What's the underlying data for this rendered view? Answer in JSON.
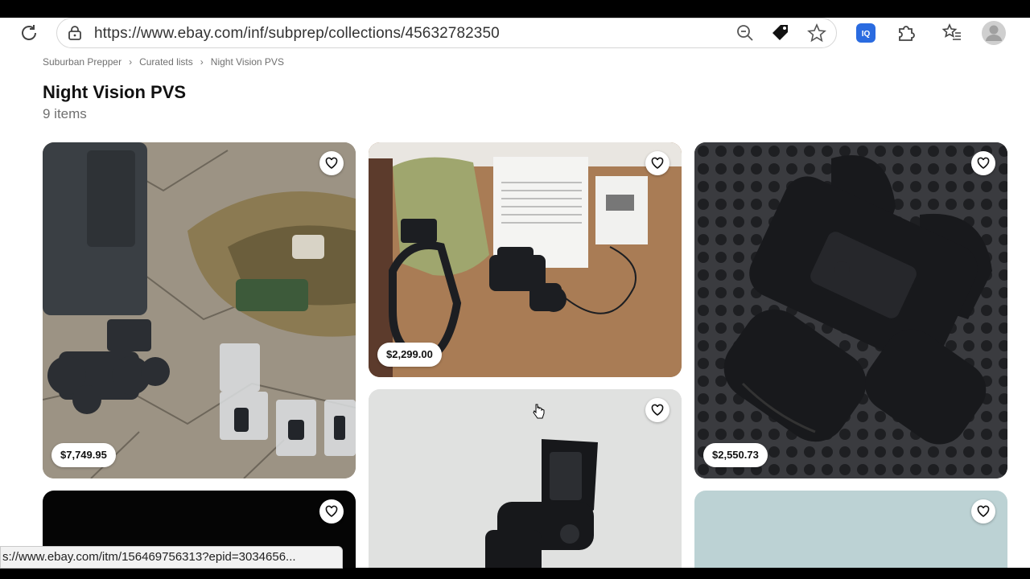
{
  "browser": {
    "url": "https://www.ebay.com/inf/subprep/collections/45632782350",
    "status_url": "s://www.ebay.com/itm/156469756313?epid=3034656..."
  },
  "breadcrumb": {
    "items": [
      "Suburban Prepper",
      "Curated lists",
      "Night Vision PVS"
    ],
    "separator": "›"
  },
  "collection": {
    "title": "Night Vision PVS",
    "count": "9 items"
  },
  "listings": [
    {
      "price": "$7,749.95"
    },
    {
      "price": "$2,299.00"
    },
    {
      "price": "$2,550.73"
    },
    {
      "price": ""
    },
    {
      "price": ""
    },
    {
      "price": ""
    }
  ],
  "icons": {
    "reload": "reload-icon",
    "lock": "lock-icon",
    "zoom": "zoom-out-icon",
    "tag": "price-tag-icon",
    "favorite": "star-icon",
    "extension_iq": "iq-extension-icon",
    "extensions": "puzzle-icon",
    "favorites": "favorites-list-icon",
    "profile": "profile-avatar-icon",
    "heart": "heart-icon"
  }
}
